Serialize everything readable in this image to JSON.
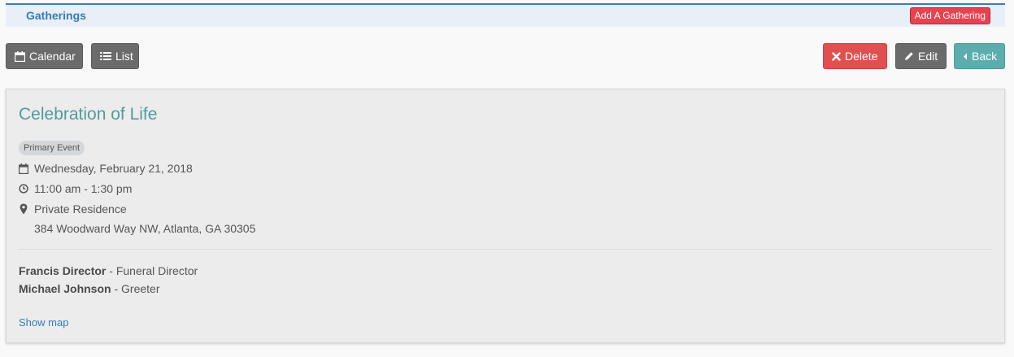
{
  "header": {
    "title": "Gatherings",
    "add_button": "Add A Gathering"
  },
  "toolbar": {
    "calendar_label": "Calendar",
    "list_label": "List",
    "delete_label": "Delete",
    "edit_label": "Edit",
    "back_label": "Back"
  },
  "event": {
    "title": "Celebration of Life",
    "badge": "Primary Event",
    "date": "Wednesday, February 21, 2018",
    "time": "11:00 am - 1:30 pm",
    "location_name": "Private Residence",
    "address": "384 Woodward Way NW, Atlanta, GA 30305",
    "staff": [
      {
        "name": "Francis Director",
        "role": " - Funeral Director"
      },
      {
        "name": "Michael Johnson",
        "role": " - Greeter"
      }
    ],
    "map_link": "Show map"
  },
  "colors": {
    "accent": "#3a7ab8",
    "title_teal": "#4f9c9c",
    "danger": "#e05050",
    "dark_button": "#6b6b6b",
    "back_button": "#5cadad"
  }
}
